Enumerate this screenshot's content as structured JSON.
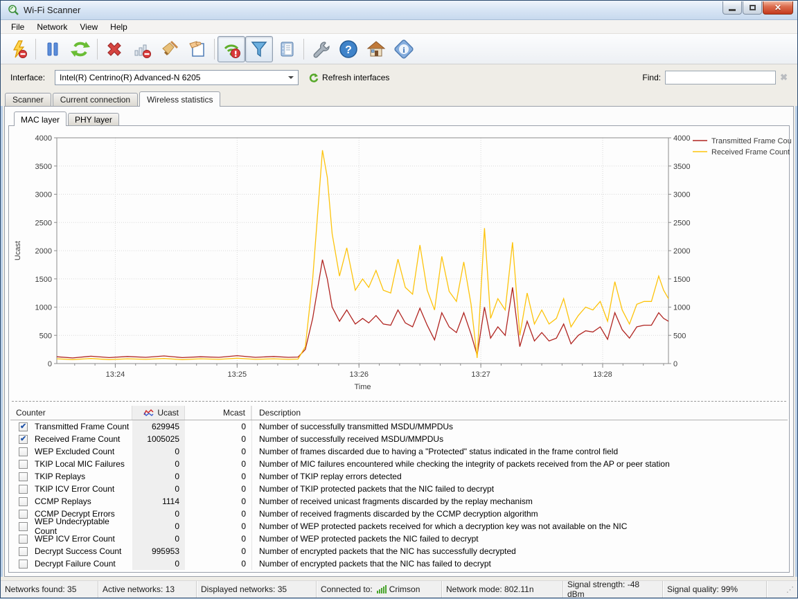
{
  "window": {
    "title": "Wi-Fi Scanner"
  },
  "menu": {
    "items": [
      "File",
      "Network",
      "View",
      "Help"
    ]
  },
  "interface_bar": {
    "label": "Interface:",
    "selected_interface": "Intel(R) Centrino(R) Advanced-N 6205",
    "refresh_label": "Refresh interfaces",
    "find_label": "Find:",
    "find_value": ""
  },
  "tabs": {
    "items": [
      "Scanner",
      "Current connection",
      "Wireless statistics"
    ],
    "active": "Wireless statistics"
  },
  "subtabs": {
    "items": [
      "MAC layer",
      "PHY layer"
    ],
    "active": "MAC layer"
  },
  "chart_data": {
    "type": "line",
    "xlabel": "Time",
    "ylabel": "Ucast",
    "ylim": [
      0,
      4000
    ],
    "y_ticks": [
      0,
      500,
      1000,
      1500,
      2000,
      2500,
      3000,
      3500,
      4000
    ],
    "x_ticks": [
      "13:24",
      "13:25",
      "13:26",
      "13:27",
      "13:28"
    ],
    "x_tick_minutes": [
      24,
      25,
      26,
      27,
      28
    ],
    "x_range_minutes": [
      23.52,
      28.54
    ],
    "grid": true,
    "legend_position": "top-right",
    "x": [
      23.52,
      23.65,
      23.8,
      23.95,
      24.1,
      24.25,
      24.4,
      24.55,
      24.7,
      24.85,
      25.0,
      25.15,
      25.3,
      25.42,
      25.5,
      25.56,
      25.62,
      25.7,
      25.74,
      25.78,
      25.84,
      25.9,
      25.97,
      26.03,
      26.08,
      26.14,
      26.2,
      26.26,
      26.32,
      26.38,
      26.44,
      26.5,
      26.56,
      26.62,
      26.68,
      26.74,
      26.8,
      26.86,
      26.92,
      26.97,
      27.03,
      27.08,
      27.14,
      27.2,
      27.26,
      27.32,
      27.38,
      27.44,
      27.5,
      27.56,
      27.62,
      27.68,
      27.74,
      27.8,
      27.86,
      27.92,
      27.98,
      28.04,
      28.1,
      28.16,
      28.22,
      28.28,
      28.34,
      28.4,
      28.46,
      28.5,
      28.54
    ],
    "series": [
      {
        "name": "Transmitted Frame Count",
        "color": "#b02420",
        "values": [
          120,
          100,
          130,
          105,
          125,
          110,
          135,
          105,
          120,
          110,
          140,
          110,
          125,
          110,
          115,
          250,
          800,
          1840,
          1500,
          1000,
          750,
          950,
          700,
          800,
          720,
          850,
          700,
          680,
          950,
          720,
          650,
          980,
          680,
          420,
          900,
          650,
          550,
          900,
          520,
          150,
          1000,
          450,
          650,
          500,
          1350,
          300,
          750,
          400,
          550,
          400,
          450,
          700,
          350,
          500,
          580,
          560,
          650,
          430,
          900,
          600,
          450,
          650,
          680,
          680,
          900,
          800,
          750
        ]
      },
      {
        "name": "Received Frame Count",
        "color": "#fdc30b",
        "values": [
          85,
          70,
          90,
          70,
          85,
          75,
          90,
          70,
          85,
          75,
          95,
          75,
          85,
          75,
          80,
          300,
          1500,
          3780,
          3300,
          2300,
          1550,
          2050,
          1300,
          1500,
          1350,
          1650,
          1300,
          1250,
          1850,
          1350,
          1230,
          2100,
          1300,
          950,
          1900,
          1280,
          1100,
          1800,
          1050,
          100,
          2400,
          800,
          1150,
          950,
          2150,
          500,
          1250,
          700,
          950,
          700,
          800,
          1150,
          650,
          850,
          1000,
          950,
          1100,
          750,
          1450,
          950,
          700,
          1050,
          1100,
          1100,
          1550,
          1300,
          1150
        ]
      }
    ]
  },
  "table": {
    "columns": [
      "Counter",
      "Ucast",
      "Mcast",
      "Description"
    ],
    "rows": [
      {
        "checked": true,
        "counter": "Transmitted Frame Count",
        "ucast": "629945",
        "mcast": "0",
        "description": "Number of successfully transmitted MSDU/MMPDUs"
      },
      {
        "checked": true,
        "counter": "Received Frame Count",
        "ucast": "1005025",
        "mcast": "0",
        "description": "Number of successfully received MSDU/MMPDUs"
      },
      {
        "checked": false,
        "counter": "WEP Excluded Count",
        "ucast": "0",
        "mcast": "0",
        "description": "Number of frames discarded due to having a \"Protected\" status indicated in the frame control field"
      },
      {
        "checked": false,
        "counter": "TKIP Local MIC Failures",
        "ucast": "0",
        "mcast": "0",
        "description": "Number of MIC failures encountered while checking the integrity of packets received from the AP or peer station"
      },
      {
        "checked": false,
        "counter": "TKIP Replays",
        "ucast": "0",
        "mcast": "0",
        "description": "Number of TKIP replay errors detected"
      },
      {
        "checked": false,
        "counter": "TKIP ICV Error Count",
        "ucast": "0",
        "mcast": "0",
        "description": "Number of TKIP protected packets that the NIC failed to decrypt"
      },
      {
        "checked": false,
        "counter": "CCMP Replays",
        "ucast": "1114",
        "mcast": "0",
        "description": "Number of received unicast fragments discarded by the replay mechanism"
      },
      {
        "checked": false,
        "counter": "CCMP Decrypt Errors",
        "ucast": "0",
        "mcast": "0",
        "description": "Number of received fragments discarded by the CCMP decryption algorithm"
      },
      {
        "checked": false,
        "counter": "WEP Undecryptable Count",
        "ucast": "0",
        "mcast": "0",
        "description": "Number of WEP protected packets received for which a decryption key was not available on the NIC"
      },
      {
        "checked": false,
        "counter": "WEP ICV Error Count",
        "ucast": "0",
        "mcast": "0",
        "description": "Number of WEP protected packets the NIC failed to decrypt"
      },
      {
        "checked": false,
        "counter": "Decrypt Success Count",
        "ucast": "995953",
        "mcast": "0",
        "description": "Number of encrypted packets that the NIC has successfully decrypted"
      },
      {
        "checked": false,
        "counter": "Decrypt Failure Count",
        "ucast": "0",
        "mcast": "0",
        "description": "Number of encrypted packets that the NIC has failed to decrypt"
      }
    ]
  },
  "status_bar": {
    "networks_found": "Networks found: 35",
    "active_networks": "Active networks: 13",
    "displayed_networks": "Displayed networks: 35",
    "connected_to_label": "Connected to:",
    "connected_to_value": "Crimson",
    "network_mode": "Network mode: 802.11n",
    "signal_strength": "Signal strength: -48 dBm",
    "signal_quality": "Signal quality: 99%"
  }
}
